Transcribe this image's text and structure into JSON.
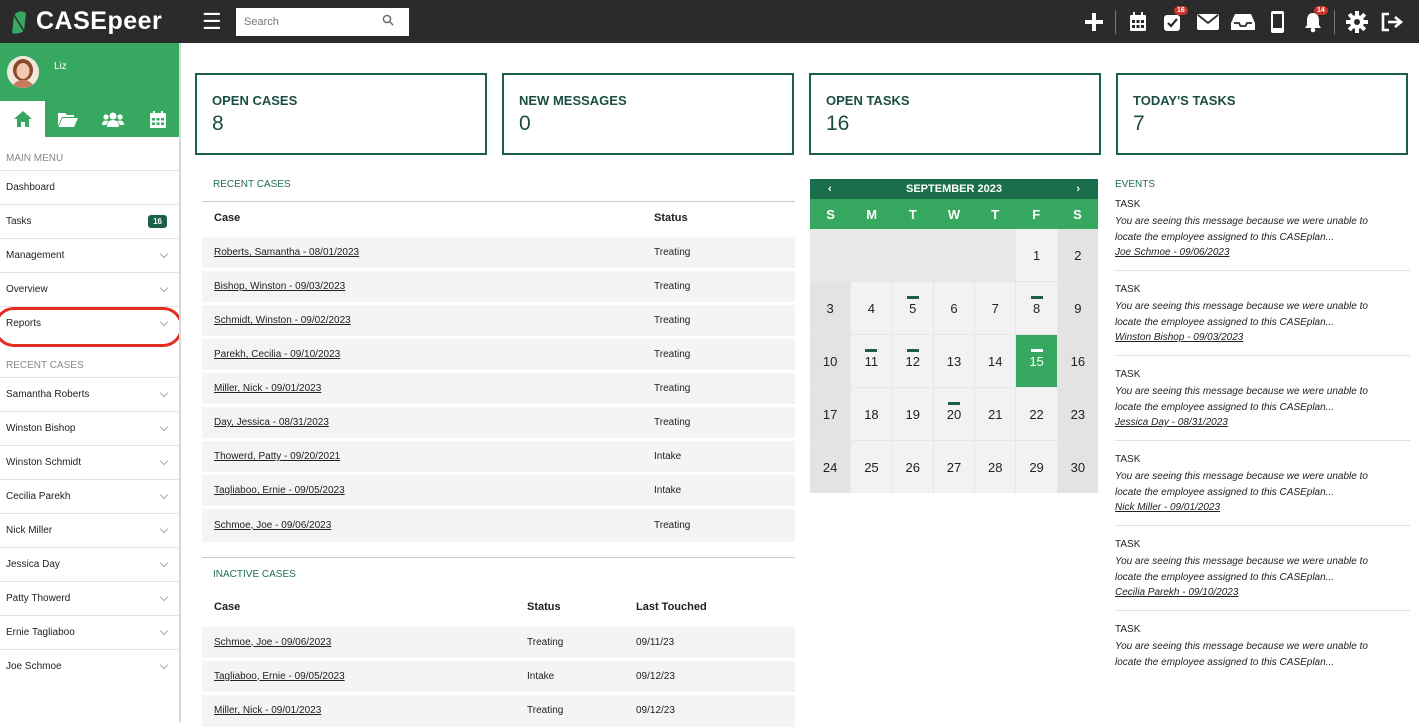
{
  "app": {
    "logo_text": "CASEpeer"
  },
  "topbar": {
    "search_placeholder": "Search",
    "icons": [
      {
        "name": "plus-icon"
      },
      {
        "name": "calendar-icon"
      },
      {
        "name": "tasks-check-icon",
        "badge": "16"
      },
      {
        "name": "envelope-icon"
      },
      {
        "name": "inbox-tray-icon"
      },
      {
        "name": "mobile-phone-icon"
      },
      {
        "name": "bell-icon",
        "badge": "14"
      },
      {
        "name": "gear-icon"
      },
      {
        "name": "sign-out-icon"
      }
    ]
  },
  "sidebar": {
    "user_name": "Liz",
    "tabs": [
      "home-icon",
      "folder-open-icon",
      "users-icon",
      "calendar-icon"
    ],
    "main_menu_title": "MAIN MENU",
    "main_menu": [
      {
        "label": "Dashboard",
        "badge": ""
      },
      {
        "label": "Tasks",
        "badge": "16"
      },
      {
        "label": "Management",
        "badge": ""
      },
      {
        "label": "Overview",
        "badge": ""
      },
      {
        "label": "Reports",
        "badge": ""
      }
    ],
    "recent_title": "RECENT CASES",
    "recent_cases": [
      "Samantha Roberts",
      "Winston Bishop",
      "Winston Schmidt",
      "Cecilia Parekh",
      "Nick Miller",
      "Jessica Day",
      "Patty Thowerd",
      "Ernie Tagliaboo",
      "Joe Schmoe"
    ]
  },
  "stats": [
    {
      "label": "OPEN CASES",
      "value": "8"
    },
    {
      "label": "NEW MESSAGES",
      "value": "0"
    },
    {
      "label": "OPEN TASKS",
      "value": "16"
    },
    {
      "label": "TODAY'S TASKS",
      "value": "7"
    }
  ],
  "recent_cases": {
    "title": "RECENT CASES",
    "headers": [
      "Case",
      "Status"
    ],
    "rows": [
      [
        "Roberts, Samantha - 08/01/2023",
        "Treating"
      ],
      [
        "Bishop, Winston - 09/03/2023",
        "Treating"
      ],
      [
        "Schmidt, Winston - 09/02/2023",
        "Treating"
      ],
      [
        "Parekh, Cecilia - 09/10/2023",
        "Treating"
      ],
      [
        "Miller, Nick - 09/01/2023",
        "Treating"
      ],
      [
        "Day, Jessica - 08/31/2023",
        "Treating"
      ],
      [
        "Thowerd, Patty - 09/20/2021",
        "Intake"
      ],
      [
        "Tagliaboo, Ernie - 09/05/2023",
        "Intake"
      ],
      [
        "Schmoe, Joe - 09/06/2023",
        "Treating"
      ]
    ]
  },
  "inactive_cases": {
    "title": "INACTIVE CASES",
    "headers": [
      "Case",
      "Status",
      "Last Touched"
    ],
    "rows": [
      [
        "Schmoe, Joe - 09/06/2023",
        "Treating",
        "09/11/23"
      ],
      [
        "Tagliaboo, Ernie - 09/05/2023",
        "Intake",
        "09/12/23"
      ],
      [
        "Miller, Nick - 09/01/2023",
        "Treating",
        "09/12/23"
      ]
    ]
  },
  "calendar": {
    "month": "SEPTEMBER 2023",
    "prev": "‹",
    "next": "›",
    "dow": [
      "S",
      "M",
      "T",
      "W",
      "T",
      "F",
      "S"
    ],
    "weeks": [
      [
        "",
        "",
        "",
        "",
        "",
        "1",
        "2"
      ],
      [
        "3",
        "4",
        "5",
        "6",
        "7",
        "8",
        "9"
      ],
      [
        "10",
        "11",
        "12",
        "13",
        "14",
        "15",
        "16"
      ],
      [
        "17",
        "18",
        "19",
        "20",
        "21",
        "22",
        "23"
      ],
      [
        "24",
        "25",
        "26",
        "27",
        "28",
        "29",
        "30"
      ]
    ],
    "today": "15",
    "marked_days": [
      "5",
      "8",
      "11",
      "12",
      "15",
      "20"
    ]
  },
  "events": {
    "title": "EVENTS",
    "items": [
      {
        "type": "TASK",
        "line1": "You are seeing this message because we were unable to",
        "line2": "locate the employee assigned to this CASEplan...",
        "link": "Joe Schmoe - 09/06/2023"
      },
      {
        "type": "TASK",
        "line1": "You are seeing this message because we were unable to",
        "line2": "locate the employee assigned to this CASEplan...",
        "link": "Winston Bishop - 09/03/2023"
      },
      {
        "type": "TASK",
        "line1": "You are seeing this message because we were unable to",
        "line2": "locate the employee assigned to this CASEplan...",
        "link": "Jessica Day - 08/31/2023"
      },
      {
        "type": "TASK",
        "line1": "You are seeing this message because we were unable to",
        "line2": "locate the employee assigned to this CASEplan...",
        "link": "Nick Miller - 09/01/2023"
      },
      {
        "type": "TASK",
        "line1": "You are seeing this message because we were unable to",
        "line2": "locate the employee assigned to this CASEplan...",
        "link": "Cecilia Parekh - 09/10/2023"
      },
      {
        "type": "TASK",
        "line1": "You are seeing this message because we were unable to",
        "line2": "locate the employee assigned to this CASEplan...",
        "link": ""
      }
    ]
  },
  "colors": {
    "brand_green": "#36a85f",
    "dark_green": "#1b5e4c",
    "topbar": "#2b2b2b",
    "badge_red": "#c9342b",
    "highlight_red": "#e32c22"
  }
}
